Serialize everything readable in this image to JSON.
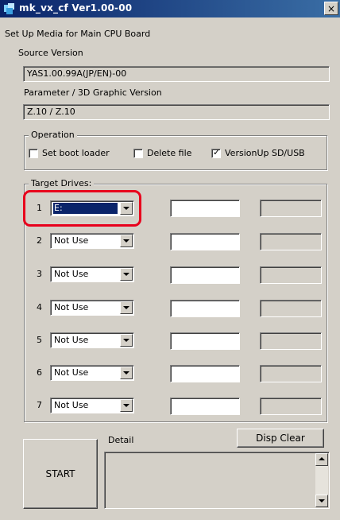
{
  "window": {
    "title": "mk_vx_cf Ver1.00-00",
    "close_glyph": "×"
  },
  "header": {
    "setup_label": "Set Up Media for Main CPU Board",
    "source_version_label": "Source Version",
    "source_version_value": "YAS1.00.99A(JP/EN)-00",
    "param_label": "Parameter / 3D Graphic Version",
    "param_value": "Z.10 / Z.10"
  },
  "operation": {
    "title": "Operation",
    "options": [
      {
        "label": "Set boot loader",
        "checked": false
      },
      {
        "label": "Delete file",
        "checked": false
      },
      {
        "label": "VersionUp SD/USB",
        "checked": true
      }
    ],
    "check_glyph": "✓"
  },
  "target_drives": {
    "title": "Target Drives:",
    "drives": [
      {
        "num": "1",
        "value": "E:",
        "selected": true
      },
      {
        "num": "2",
        "value": "Not Use",
        "selected": false
      },
      {
        "num": "3",
        "value": "Not Use",
        "selected": false
      },
      {
        "num": "4",
        "value": "Not Use",
        "selected": false
      },
      {
        "num": "5",
        "value": "Not Use",
        "selected": false
      },
      {
        "num": "6",
        "value": "Not Use",
        "selected": false
      },
      {
        "num": "7",
        "value": "Not Use",
        "selected": false
      }
    ]
  },
  "bottom": {
    "detail_label": "Detail",
    "disp_clear_label": "Disp Clear",
    "start_label": "START"
  },
  "colors": {
    "highlight": "#e8001c",
    "title_bar": "#0a246a",
    "selection": "#0a246a"
  }
}
